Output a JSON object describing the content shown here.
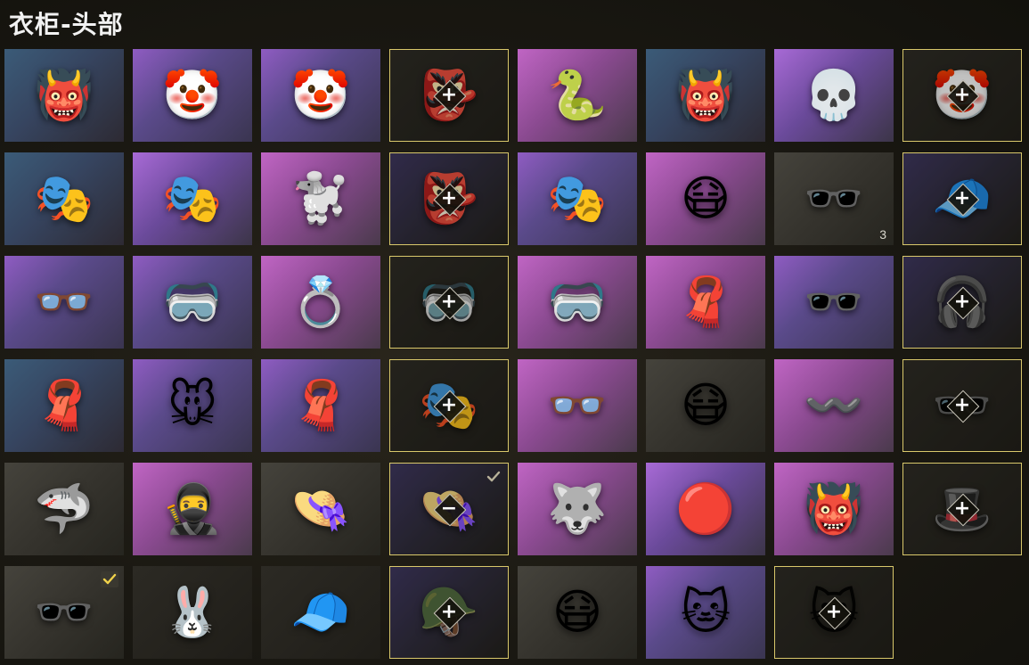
{
  "title": "衣柜-头部",
  "items": [
    {
      "icon": "oni-mask-icon",
      "glyph": "👹",
      "bg": "blue",
      "selected": false
    },
    {
      "icon": "clown-mask-icon",
      "glyph": "🤡",
      "bg": "purple",
      "selected": false
    },
    {
      "icon": "clown-mask-icon",
      "glyph": "🤡",
      "bg": "purple",
      "selected": false
    },
    {
      "icon": "demon-mask-icon",
      "glyph": "👺",
      "bg": "dark",
      "selected": true,
      "action": "+"
    },
    {
      "icon": "medusa-mask-icon",
      "glyph": "🐍",
      "bg": "pink",
      "selected": false
    },
    {
      "icon": "red-skull-mask-icon",
      "glyph": "👹",
      "bg": "blue",
      "selected": false
    },
    {
      "icon": "skull-mask-icon",
      "glyph": "💀",
      "bg": "violet",
      "selected": false
    },
    {
      "icon": "clown-mask-icon",
      "glyph": "🤡",
      "bg": "dark",
      "selected": true,
      "action": "+"
    },
    {
      "icon": "joker-mask-icon",
      "glyph": "🎭",
      "bg": "blue",
      "selected": false
    },
    {
      "icon": "tribal-mask-icon",
      "glyph": "🎭",
      "bg": "violet",
      "selected": false
    },
    {
      "icon": "poodle-mask-icon",
      "glyph": "🐩",
      "bg": "pink",
      "selected": false
    },
    {
      "icon": "oni-mask-icon",
      "glyph": "👺",
      "bg": "darkpurple",
      "selected": true,
      "action": "+"
    },
    {
      "icon": "kabuki-mask-icon",
      "glyph": "🎭",
      "bg": "purple",
      "selected": false
    },
    {
      "icon": "gas-mask-icon",
      "glyph": "😷",
      "bg": "pink",
      "selected": false
    },
    {
      "icon": "shutter-glasses-icon",
      "glyph": "🕶️",
      "bg": "gray",
      "selected": false,
      "count": "3"
    },
    {
      "icon": "beanie-icon",
      "glyph": "🧢",
      "bg": "darkpurple",
      "selected": true,
      "action": "+"
    },
    {
      "icon": "round-glasses-icon",
      "glyph": "👓",
      "bg": "purple",
      "selected": false
    },
    {
      "icon": "visor-glasses-icon",
      "glyph": "🥽",
      "bg": "purple",
      "selected": false
    },
    {
      "icon": "earrings-icon",
      "glyph": "💍",
      "bg": "pink",
      "selected": false
    },
    {
      "icon": "goggles-icon",
      "glyph": "🥽",
      "bg": "dark",
      "selected": true,
      "action": "+"
    },
    {
      "icon": "cyber-visor-icon",
      "glyph": "🥽",
      "bg": "pink",
      "selected": false
    },
    {
      "icon": "bandana-icon",
      "glyph": "🧣",
      "bg": "pink",
      "selected": false
    },
    {
      "icon": "sport-glasses-icon",
      "glyph": "🕶️",
      "bg": "purple",
      "selected": false
    },
    {
      "icon": "headset-cap-icon",
      "glyph": "🎧",
      "bg": "darkpurple",
      "selected": true,
      "action": "+"
    },
    {
      "icon": "face-cover-icon",
      "glyph": "🧣",
      "bg": "blue",
      "selected": false
    },
    {
      "icon": "cute-mask-icon",
      "glyph": "🐭",
      "bg": "purple",
      "selected": false
    },
    {
      "icon": "red-scarf-icon",
      "glyph": "🧣",
      "bg": "purple",
      "selected": false
    },
    {
      "icon": "leather-mask-icon",
      "glyph": "🎭",
      "bg": "dark",
      "selected": true,
      "action": "+"
    },
    {
      "icon": "star-glasses-icon",
      "glyph": "👓",
      "bg": "pink",
      "selected": false
    },
    {
      "icon": "face-mask-icon",
      "glyph": "😷",
      "bg": "gray",
      "selected": false
    },
    {
      "icon": "fur-headband-icon",
      "glyph": "〰️",
      "bg": "pink",
      "selected": false
    },
    {
      "icon": "sunglasses-icon",
      "glyph": "🕶️",
      "bg": "dark",
      "selected": true,
      "action": "+"
    },
    {
      "icon": "shark-hat-icon",
      "glyph": "🦈",
      "bg": "gray",
      "selected": false
    },
    {
      "icon": "balaclava-icon",
      "glyph": "🥷",
      "bg": "pink",
      "selected": false
    },
    {
      "icon": "bucket-hat-icon",
      "glyph": "👒",
      "bg": "gray",
      "selected": false
    },
    {
      "icon": "camo-bucket-hat-icon",
      "glyph": "👒",
      "bg": "darkpurple",
      "selected": true,
      "action": "−",
      "checked": true
    },
    {
      "icon": "wolf-mask-icon",
      "glyph": "🐺",
      "bg": "pink",
      "selected": false
    },
    {
      "icon": "clown-nose-icon",
      "glyph": "🔴",
      "bg": "violet",
      "selected": false
    },
    {
      "icon": "hannya-mask-icon",
      "glyph": "👹",
      "bg": "pink",
      "selected": false
    },
    {
      "icon": "wide-hat-icon",
      "glyph": "🎩",
      "bg": "dark",
      "selected": true,
      "action": "+"
    },
    {
      "icon": "purple-sunglasses-icon",
      "glyph": "🕶️",
      "bg": "gray",
      "selected": false,
      "checked": true,
      "checkbox": true
    },
    {
      "icon": "bunny-ears-icon",
      "glyph": "🐰",
      "bg": "dark",
      "selected": false
    },
    {
      "icon": "baseball-cap-icon",
      "glyph": "🧢",
      "bg": "dark",
      "selected": false
    },
    {
      "icon": "armor-mask-icon",
      "glyph": "🪖",
      "bg": "darkpurple",
      "selected": true,
      "action": "+"
    },
    {
      "icon": "tactical-mask-icon",
      "glyph": "😷",
      "bg": "gray",
      "selected": false
    },
    {
      "icon": "cat-ears-icon",
      "glyph": "🐱",
      "bg": "purple",
      "selected": false
    },
    {
      "icon": "cat-ears-icon",
      "glyph": "🐱",
      "bg": "dark",
      "selected": true,
      "action": "+"
    }
  ]
}
